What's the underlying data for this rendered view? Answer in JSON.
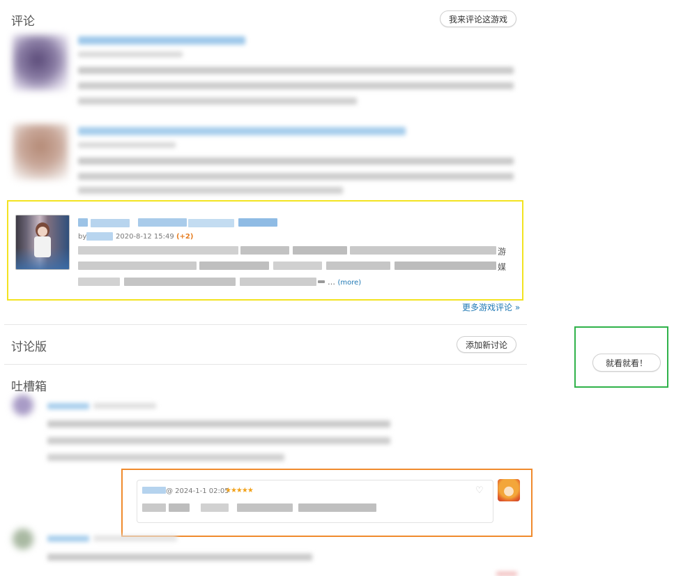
{
  "reviews": {
    "title": "评论",
    "write_button": "我来评论这游戏",
    "highlighted_review": {
      "by_prefix": "by",
      "date": "2020-8-12 15:49",
      "score_delta": "(+2)",
      "text_end_left": "游",
      "text_end_right": "媒",
      "ellipsis": "…",
      "more_label": "(more)"
    },
    "more_reviews_link": "更多游戏评论 »"
  },
  "discussion": {
    "title": "讨论版",
    "add_button": "添加新讨论"
  },
  "side": {
    "look_button": "就看就看！"
  },
  "rants": {
    "title": "吐槽箱",
    "highlighted_rant": {
      "at_date": "@ 2024-1-1 02:05",
      "stars": "★★★★★"
    }
  },
  "colors": {
    "link_blue": "#1f78b4",
    "score_orange": "#e67e22",
    "star_orange": "#f2a21b",
    "frame_yellow": "#f3e320",
    "frame_green": "#2fb24a",
    "frame_orange": "#f08a2c"
  }
}
